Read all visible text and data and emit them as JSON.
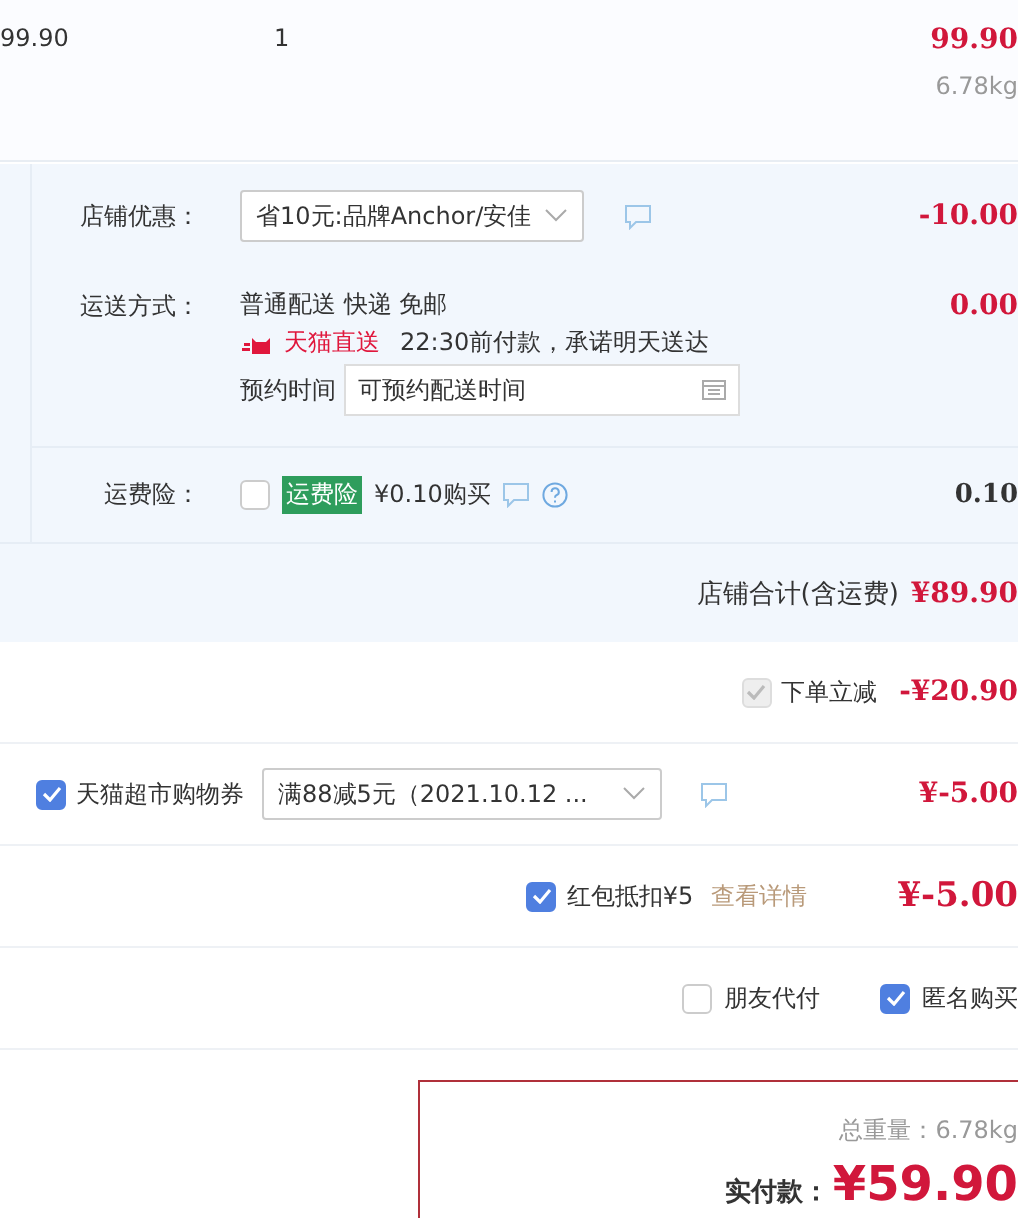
{
  "item": {
    "unit_price": "99.90",
    "quantity": "1",
    "subtotal": "99.90",
    "weight": "6.78kg"
  },
  "store_discount": {
    "label": "店铺优惠：",
    "value": "省10元:品牌Anchor/安佳",
    "amount": "-10.00"
  },
  "shipping": {
    "label": "运送方式：",
    "method": "普通配送 快递 免邮",
    "brand": "天猫直送",
    "promise": "22:30前付款，承诺明天送达",
    "schedule_label": "预约时间",
    "schedule_placeholder": "可预约配送时间",
    "amount": "0.00"
  },
  "insurance": {
    "label": "运费险：",
    "checked": false,
    "tag": "运费险",
    "price": "¥0.10购买",
    "amount": "0.10"
  },
  "store_total": {
    "label": "店铺合计(含运费)",
    "amount": "¥89.90"
  },
  "instant_discount": {
    "checked": true,
    "disabled": true,
    "label": "下单立减",
    "amount": "-¥20.90"
  },
  "coupon": {
    "checked": true,
    "label": "天猫超市购物券",
    "value": "满88减5元（2021.10.12 ...",
    "amount": "¥-5.00"
  },
  "red_packet": {
    "checked": true,
    "label": "红包抵扣¥5",
    "link": "查看详情",
    "amount": "¥-5.00"
  },
  "options": [
    {
      "label": "朋友代付",
      "checked": false
    },
    {
      "label": "匿名购买",
      "checked": true
    }
  ],
  "summary": {
    "weight": "总重量：6.78kg",
    "pay_label": "实付款：",
    "pay_amount": "¥59.90"
  }
}
